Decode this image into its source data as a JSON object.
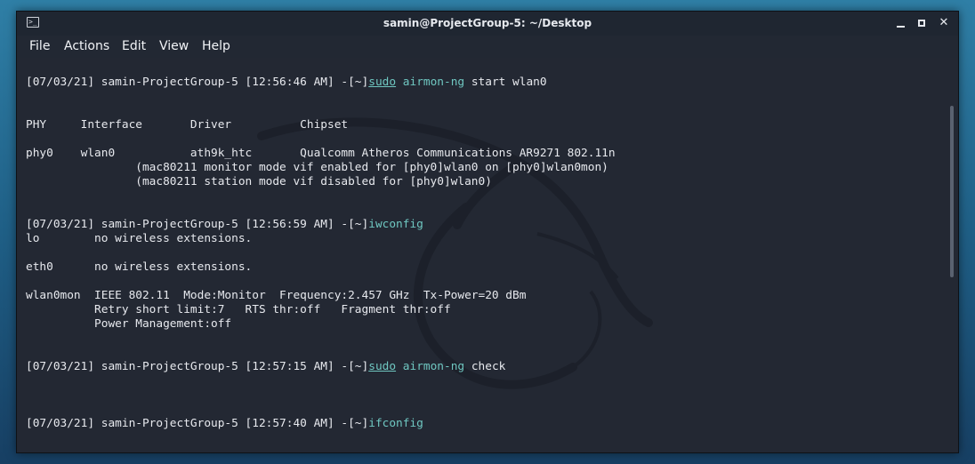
{
  "window": {
    "title": "samin@ProjectGroup-5: ~/Desktop"
  },
  "menu": {
    "items": [
      "File",
      "Actions",
      "Edit",
      "View",
      "Help"
    ]
  },
  "terminal": {
    "lines": [
      {
        "type": "prompt",
        "prompt": "[07/03/21] samin-ProjectGroup-5 [12:56:46 AM] -[~]",
        "sudo": "sudo",
        "cmd": "airmon-ng",
        "args": " start wlan0"
      },
      {
        "type": "blank"
      },
      {
        "type": "blank"
      },
      {
        "type": "text",
        "text": "PHY     Interface       Driver          Chipset"
      },
      {
        "type": "blank"
      },
      {
        "type": "text",
        "text": "phy0    wlan0           ath9k_htc       Qualcomm Atheros Communications AR9271 802.11n"
      },
      {
        "type": "text",
        "text": "                (mac80211 monitor mode vif enabled for [phy0]wlan0 on [phy0]wlan0mon)"
      },
      {
        "type": "text",
        "text": "                (mac80211 station mode vif disabled for [phy0]wlan0)"
      },
      {
        "type": "blank"
      },
      {
        "type": "blank"
      },
      {
        "type": "prompt",
        "prompt": "[07/03/21] samin-ProjectGroup-5 [12:56:59 AM] -[~]",
        "sudo": "",
        "cmd": "iwconfig",
        "args": ""
      },
      {
        "type": "text",
        "text": "lo        no wireless extensions."
      },
      {
        "type": "blank"
      },
      {
        "type": "text",
        "text": "eth0      no wireless extensions."
      },
      {
        "type": "blank"
      },
      {
        "type": "text",
        "text": "wlan0mon  IEEE 802.11  Mode:Monitor  Frequency:2.457 GHz  Tx-Power=20 dBm"
      },
      {
        "type": "text",
        "text": "          Retry short limit:7   RTS thr:off   Fragment thr:off"
      },
      {
        "type": "text",
        "text": "          Power Management:off"
      },
      {
        "type": "blank"
      },
      {
        "type": "blank"
      },
      {
        "type": "prompt",
        "prompt": "[07/03/21] samin-ProjectGroup-5 [12:57:15 AM] -[~]",
        "sudo": "sudo",
        "cmd": "airmon-ng",
        "args": " check"
      },
      {
        "type": "blank"
      },
      {
        "type": "blank"
      },
      {
        "type": "blank"
      },
      {
        "type": "prompt",
        "prompt": "[07/03/21] samin-ProjectGroup-5 [12:57:40 AM] -[~]",
        "sudo": "",
        "cmd": "ifconfig",
        "args": ""
      }
    ]
  },
  "colors": {
    "command": "#6fc7c1",
    "background": "#232833",
    "text": "#e7e9ee"
  }
}
